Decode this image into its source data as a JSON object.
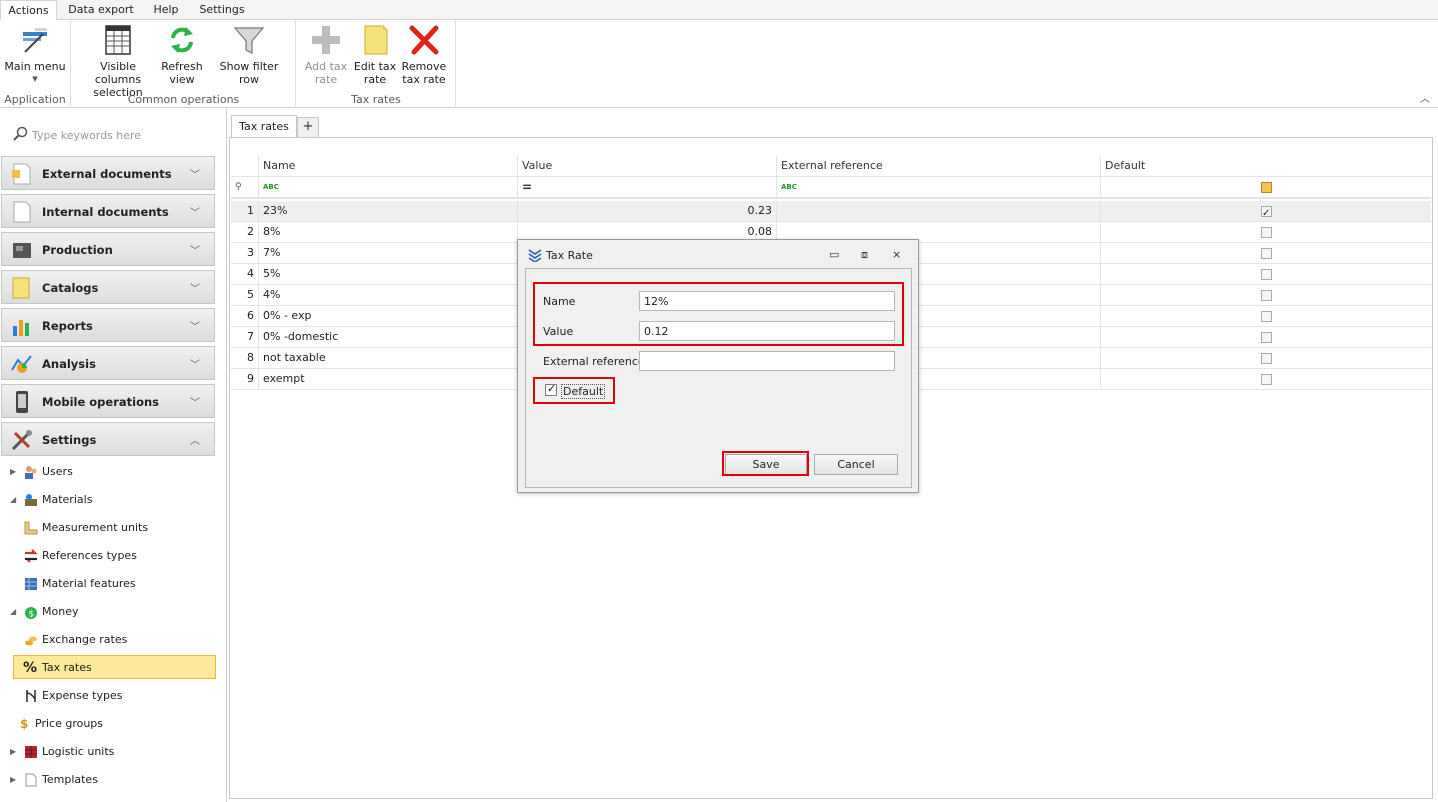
{
  "ribbon": {
    "tabs": [
      "Actions",
      "Data export",
      "Help",
      "Settings"
    ],
    "groups": {
      "application": {
        "label": "Application",
        "main_menu": "Main menu"
      },
      "common": {
        "label": "Common operations",
        "visible_columns_1": "Visible columns",
        "visible_columns_2": "selection",
        "refresh_1": "Refresh",
        "refresh_2": "view",
        "show_filter": "Show filter row"
      },
      "tax": {
        "label": "Tax rates",
        "add_1": "Add tax",
        "add_2": "rate",
        "edit_1": "Edit tax",
        "edit_2": "rate",
        "remove_1": "Remove",
        "remove_2": "tax rate"
      }
    }
  },
  "sidebar": {
    "search_placeholder": "Type keywords here",
    "groups": [
      "External documents",
      "Internal documents",
      "Production",
      "Catalogs",
      "Reports",
      "Analysis",
      "Mobile operations",
      "Settings"
    ],
    "tree": {
      "users": "Users",
      "materials": "Materials",
      "measurement_units": "Measurement units",
      "references_types": "References types",
      "material_features": "Material features",
      "money": "Money",
      "exchange_rates": "Exchange rates",
      "tax_rates": "Tax rates",
      "expense_types": "Expense types",
      "price_groups": "Price groups",
      "logistic_units": "Logistic units",
      "templates": "Templates"
    }
  },
  "main": {
    "tab_label": "Tax rates",
    "tab_add": "+",
    "grid": {
      "columns": [
        "Name",
        "Value",
        "External reference",
        "Default"
      ],
      "filter_text_icon": "ABC",
      "filter_equals_icon": "=",
      "rows": [
        {
          "num": "1",
          "name": "23%",
          "value": "0.23",
          "ext": "",
          "default": true
        },
        {
          "num": "2",
          "name": "8%",
          "value": "0.08",
          "ext": "",
          "default": false
        },
        {
          "num": "3",
          "name": "7%",
          "value": "",
          "ext": "",
          "default": false
        },
        {
          "num": "4",
          "name": "5%",
          "value": "",
          "ext": "",
          "default": false
        },
        {
          "num": "5",
          "name": "4%",
          "value": "",
          "ext": "",
          "default": false
        },
        {
          "num": "6",
          "name": "0% - exp",
          "value": "",
          "ext": "",
          "default": false
        },
        {
          "num": "7",
          "name": "0% -domestic",
          "value": "",
          "ext": "",
          "default": false
        },
        {
          "num": "8",
          "name": "not taxable",
          "value": "",
          "ext": "",
          "default": false
        },
        {
          "num": "9",
          "name": "exempt",
          "value": "",
          "ext": "",
          "default": false
        }
      ]
    }
  },
  "dialog": {
    "title": "Tax Rate",
    "name_label": "Name",
    "name_value": "12%",
    "value_label": "Value",
    "value_value": "0.12",
    "ext_label": "External reference",
    "ext_value": "",
    "default_label": "Default",
    "default_checked": true,
    "save": "Save",
    "cancel": "Cancel"
  },
  "colors": {
    "highlight": "#e0000c",
    "selected_bg": "#fde99a"
  }
}
